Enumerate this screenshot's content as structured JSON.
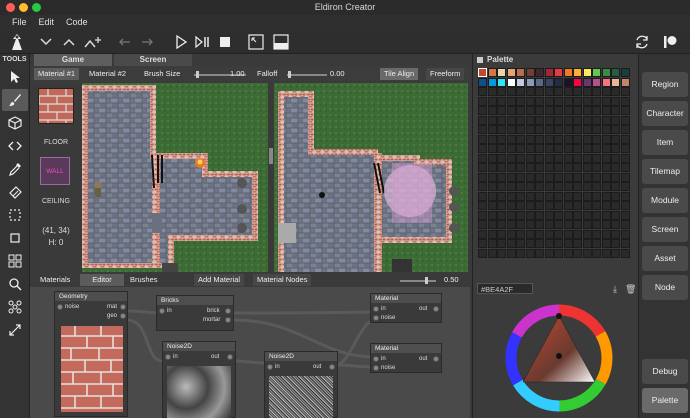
{
  "window": {
    "title": "Eldiron Creator"
  },
  "menubar": {
    "items": [
      "File",
      "Edit",
      "Code"
    ]
  },
  "tools": {
    "label": "TOOLS"
  },
  "view_tabs": {
    "game": "Game",
    "screen": "Screen"
  },
  "material_toolbar": {
    "material1": "Material #1",
    "material2": "Material #2",
    "brush_size_label": "Brush Size",
    "brush_size_value": "1.00",
    "falloff_label": "Falloff",
    "falloff_value": "0.00",
    "tile_align": "Tile Align",
    "freeform": "Freeform"
  },
  "side_info": {
    "floor": "FLOOR",
    "wall": "WALL",
    "ceiling": "CEILING",
    "coords": "(41, 34)",
    "height": "H: 0"
  },
  "bottom_tabs": {
    "materials": "Materials",
    "editor": "Editor",
    "brushes": "Brushes",
    "add_material": "Add Material",
    "material_nodes": "Material Nodes",
    "zoom_value": "0.50"
  },
  "nodes": {
    "geometry": {
      "title": "Geometry",
      "in_noise": "noise",
      "out_mat": "mat",
      "out_geo": "geo"
    },
    "bricks": {
      "title": "Bricks",
      "in": "in",
      "out_brick": "brick",
      "out_mortar": "mortar"
    },
    "noise1": {
      "title": "Noise2D",
      "in": "in",
      "out": "out"
    },
    "noise2": {
      "title": "Noise2D",
      "in": "in",
      "out": "out"
    },
    "material1": {
      "title": "Material",
      "in": "in",
      "in_noise": "noise",
      "out": "out"
    },
    "material2": {
      "title": "Material",
      "in": "in",
      "in_noise": "noise",
      "out": "out"
    }
  },
  "palette": {
    "title": "Palette",
    "hex_value": "#BE4A2F",
    "colors": [
      "#be4a2f",
      "#d77643",
      "#ead4aa",
      "#e4a672",
      "#b86f50",
      "#733e39",
      "#3e2731",
      "#a22633",
      "#e43b44",
      "#f77622",
      "#feae34",
      "#fee761",
      "#63c74d",
      "#3e8948",
      "#265c42",
      "#193c3e",
      "#124e89",
      "#0099db",
      "#2ce8f5",
      "#ffffff",
      "#c0cbdc",
      "#8b9bb4",
      "#5a6988",
      "#3a4466",
      "#262b44",
      "#181425",
      "#ff0044",
      "#68386c",
      "#b55088",
      "#f6757a",
      "#e8b796",
      "#c28569"
    ]
  },
  "right_panel": {
    "buttons": [
      "Region",
      "Character",
      "Item",
      "Tilemap",
      "Module",
      "Screen",
      "Asset",
      "Node"
    ],
    "debug": "Debug",
    "palette": "Palette"
  }
}
